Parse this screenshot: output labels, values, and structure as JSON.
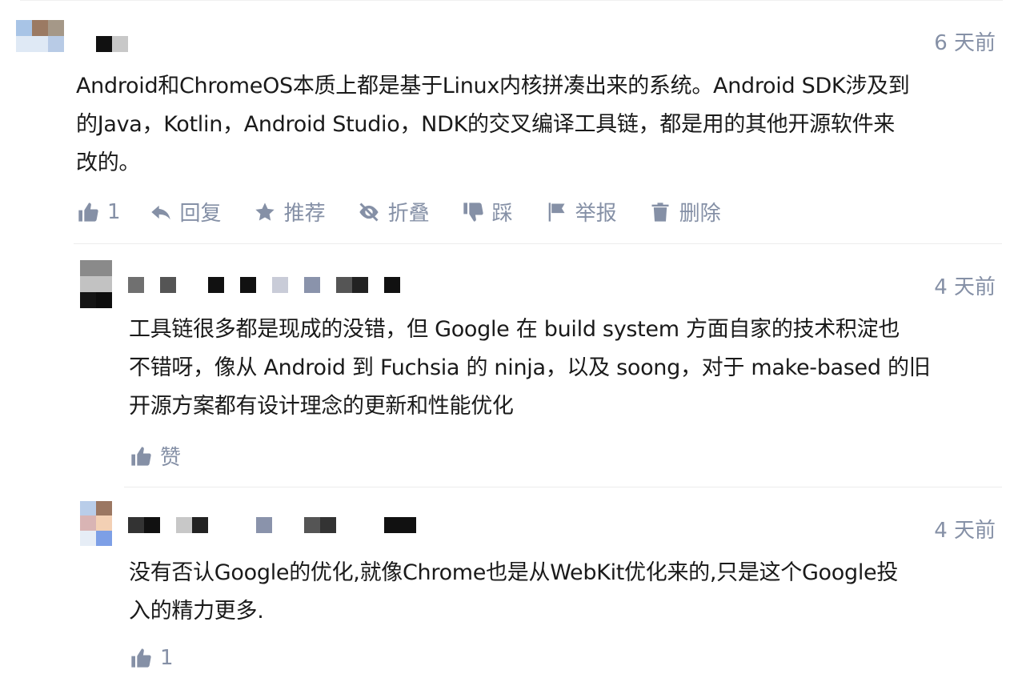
{
  "comments": [
    {
      "time": "6 天前",
      "text_lines": [
        "Android和ChromeOS本质上都是基于Linux内核拼凑出来的系统。Android SDK涉及到",
        "的Java，Kotlin，Android Studio，NDK的交叉编译工具链，都是用的其他开源软件来",
        "改的。"
      ],
      "actions": {
        "like_count": "1",
        "reply": "回复",
        "recommend": "推荐",
        "fold": "折叠",
        "downvote": "踩",
        "report": "举报",
        "delete": "删除"
      }
    },
    {
      "time": "4 天前",
      "text_lines": [
        "工具链很多都是现成的没错，但 Google 在 build system 方面自家的技术积淀也",
        "不错呀，像从 Android 到 Fuchsia 的 ninja，以及 soong，对于 make-based 的旧",
        "开源方案都有设计理念的更新和性能优化"
      ],
      "actions": {
        "like_label": "赞"
      }
    },
    {
      "time": "4 天前",
      "text_lines": [
        "没有否认Google的优化,就像Chrome也是从WebKit优化来的,只是这个Google投",
        "入的精力更多."
      ],
      "actions": {
        "like_count": "1"
      }
    }
  ],
  "icons": {
    "like": "thumbs-up-icon",
    "reply": "reply-arrow-icon",
    "recommend": "star-plus-icon",
    "fold": "eye-slash-icon",
    "downvote": "thumbs-down-icon",
    "report": "flag-icon",
    "delete": "trash-icon"
  },
  "colors": {
    "meta": "#8590a6",
    "text": "#1a1a1a"
  }
}
